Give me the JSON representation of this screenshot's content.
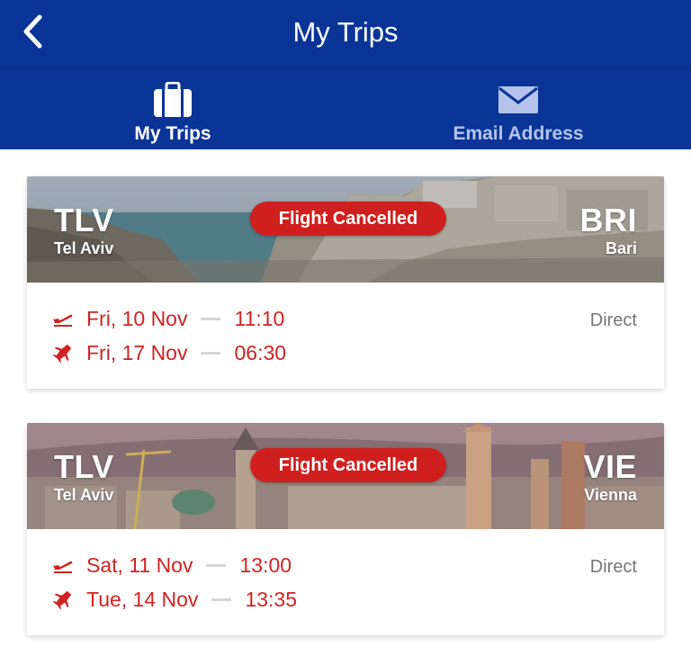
{
  "header": {
    "title": "My Trips",
    "back_icon": "chevron-left-icon"
  },
  "tabs": [
    {
      "label": "My Trips",
      "icon": "suitcase-icon",
      "active": true
    },
    {
      "label": "Email Address",
      "icon": "envelope-icon",
      "active": false
    }
  ],
  "trips": [
    {
      "origin_code": "TLV",
      "origin_city": "Tel Aviv",
      "destination_code": "BRI",
      "destination_city": "Bari",
      "status": "Flight Cancelled",
      "stops": "Direct",
      "outbound": {
        "date": "Fri, 10 Nov",
        "time": "11:10"
      },
      "inbound": {
        "date": "Fri, 17 Nov",
        "time": "06:30"
      }
    },
    {
      "origin_code": "TLV",
      "origin_city": "Tel Aviv",
      "destination_code": "VIE",
      "destination_city": "Vienna",
      "status": "Flight Cancelled",
      "stops": "Direct",
      "outbound": {
        "date": "Sat, 11 Nov",
        "time": "13:00"
      },
      "inbound": {
        "date": "Tue, 14 Nov",
        "time": "13:35"
      }
    }
  ],
  "colors": {
    "header_bg": "#0a3597",
    "accent_red": "#cf2323",
    "badge_red": "#d01f1f",
    "inactive_tab": "#b4c3ea"
  }
}
